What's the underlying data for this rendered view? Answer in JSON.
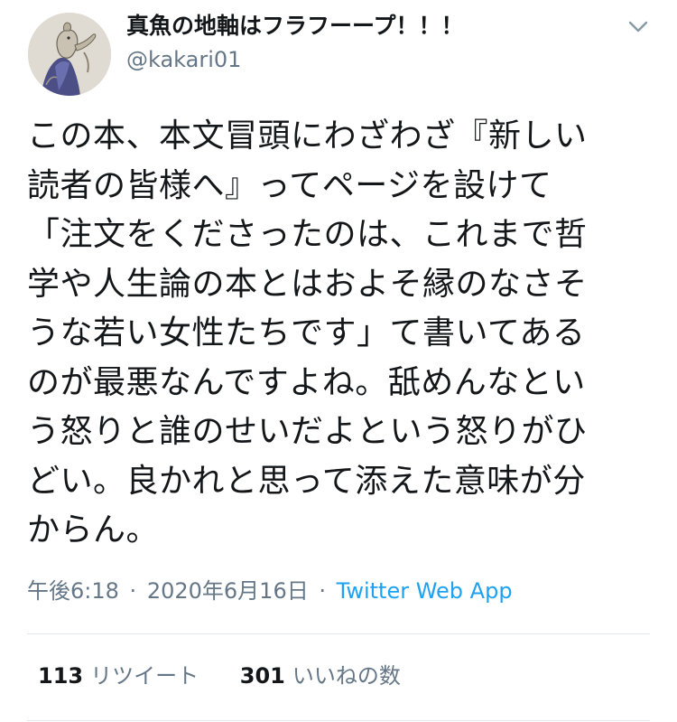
{
  "user": {
    "display_name": "真魚の地軸はフラフーープ！！！",
    "handle": "@kakari01",
    "avatar_icon": "avatar-image"
  },
  "tweet": {
    "lines": [
      "この本、本文冒頭にわざわざ『新しい",
      "読者の皆様へ』ってページを設けて",
      "「注文をくださったのは、これまで哲",
      "学や人生論の本とはおよそ縁のなさそ",
      "うな若い女性たちです」て書いてある",
      "のが最悪なんですよね。舐めんなとい",
      "う怒りと誰のせいだよという怒りがひ",
      "どい。良かれと思って添えた意味が分",
      "からん。"
    ],
    "time": "午後6:18",
    "date": "2020年6月16日",
    "separator": "·",
    "source": "Twitter Web App"
  },
  "stats": {
    "retweets_count": "113",
    "retweets_label": "リツイート",
    "likes_count": "301",
    "likes_label": "いいねの数"
  },
  "icons": {
    "menu": "chevron-down-icon"
  },
  "colors": {
    "text": "#14171a",
    "secondary": "#657786",
    "link": "#1da1f2",
    "divider": "#e1e8ed"
  }
}
